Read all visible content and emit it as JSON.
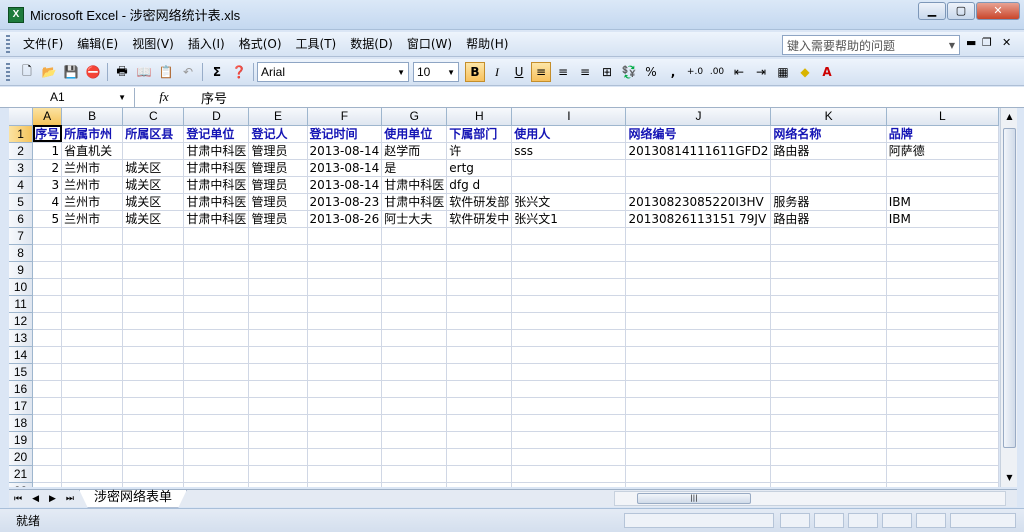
{
  "window": {
    "title": "Microsoft Excel - 涉密网络统计表.xls",
    "app_icon": "X"
  },
  "menu": [
    "文件(F)",
    "编辑(E)",
    "视图(V)",
    "插入(I)",
    "格式(O)",
    "工具(T)",
    "数据(D)",
    "窗口(W)",
    "帮助(H)"
  ],
  "help_placeholder": "键入需要帮助的问题",
  "toolbar": {
    "font": "Arial",
    "size": "10",
    "sigma": "Σ",
    "bold": "B",
    "italic": "I",
    "underline": "U",
    "percent": "%",
    "comma": ","
  },
  "formula": {
    "cell_ref": "A1",
    "fx": "fx",
    "content": "序号"
  },
  "columns": [
    "A",
    "B",
    "C",
    "D",
    "E",
    "F",
    "G",
    "H",
    "I",
    "J",
    "K",
    "L"
  ],
  "rows": [
    [
      "序号",
      "所属市州",
      "所属区县",
      "登记单位",
      "登记人",
      "登记时间",
      "使用单位",
      "下属部门",
      "使用人",
      "网络编号",
      "网络名称",
      "品牌"
    ],
    [
      "1",
      "省直机关",
      "",
      "甘肃中科医",
      "管理员",
      "2013-08-14",
      "赵学而",
      "许",
      "sss",
      "20130814111611GFD2",
      "路由器",
      "阿萨德"
    ],
    [
      "2",
      "兰州市",
      "城关区",
      "甘肃中科医",
      "管理员",
      "2013-08-14",
      "是",
      "ertg",
      "",
      "",
      "",
      ""
    ],
    [
      "3",
      "兰州市",
      "城关区",
      "甘肃中科医",
      "管理员",
      "2013-08-14",
      "甘肃中科医",
      "dfg d",
      "",
      "",
      "",
      ""
    ],
    [
      "4",
      "兰州市",
      "城关区",
      "甘肃中科医",
      "管理员",
      "2013-08-23",
      "甘肃中科医",
      "软件研发部",
      "张兴文",
      "20130823085220I3HV",
      "服务器",
      "IBM"
    ],
    [
      "5",
      "兰州市",
      "城关区",
      "甘肃中科医",
      "管理员",
      "2013-08-26",
      "阿士大夫",
      "软件研发中",
      "张兴文1",
      "20130826113151 79JV",
      "路由器",
      "IBM"
    ]
  ],
  "total_rows": 22,
  "sheet_tab": "涉密网络表单",
  "status": "就绪"
}
